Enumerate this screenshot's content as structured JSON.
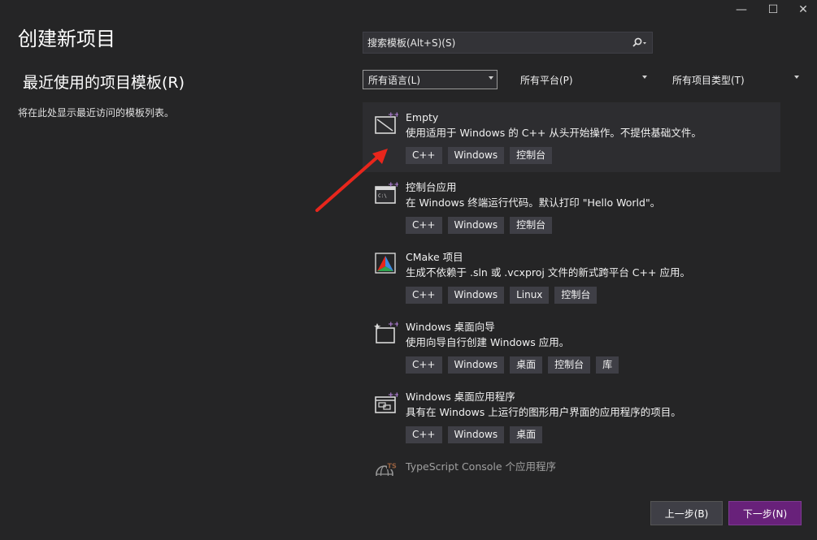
{
  "window_controls": {
    "minimize": "—",
    "maximize": "☐",
    "close": "✕"
  },
  "page": {
    "title": "创建新项目",
    "recent_title": "最近使用的项目模板(R)",
    "recent_empty": "将在此处显示最近访问的模板列表。"
  },
  "search": {
    "placeholder": "搜索模板(Alt+S)(S)",
    "icon": "search-icon"
  },
  "filters": {
    "language": "所有语言(L)",
    "platform": "所有平台(P)",
    "type": "所有项目类型(T)"
  },
  "templates": [
    {
      "name": "Empty",
      "desc": "使用适用于 Windows 的 C++ 从头开始操作。不提供基础文件。",
      "tags": [
        "C++",
        "Windows",
        "控制台"
      ],
      "icon": "empty-project-icon",
      "selected": true
    },
    {
      "name": "控制台应用",
      "desc": "在 Windows 终端运行代码。默认打印 \"Hello World\"。",
      "tags": [
        "C++",
        "Windows",
        "控制台"
      ],
      "icon": "console-app-icon"
    },
    {
      "name": "CMake 项目",
      "desc": "生成不依赖于 .sln 或 .vcxproj 文件的新式跨平台 C++ 应用。",
      "tags": [
        "C++",
        "Windows",
        "Linux",
        "控制台"
      ],
      "icon": "cmake-icon"
    },
    {
      "name": "Windows 桌面向导",
      "desc": "使用向导自行创建 Windows 应用。",
      "tags": [
        "C++",
        "Windows",
        "桌面",
        "控制台",
        "库"
      ],
      "icon": "wizard-icon"
    },
    {
      "name": "Windows 桌面应用程序",
      "desc": "具有在 Windows 上运行的图形用户界面的应用程序的项目。",
      "tags": [
        "C++",
        "Windows",
        "桌面"
      ],
      "icon": "desktop-app-icon"
    },
    {
      "name": "TypeScript Console 个应用程序",
      "icon": "typescript-icon"
    }
  ],
  "buttons": {
    "back": "上一步(B)",
    "next": "下一步(N)"
  },
  "colors": {
    "background": "#252526",
    "accent": "#68217a",
    "annotation_arrow": "#e8261c"
  }
}
